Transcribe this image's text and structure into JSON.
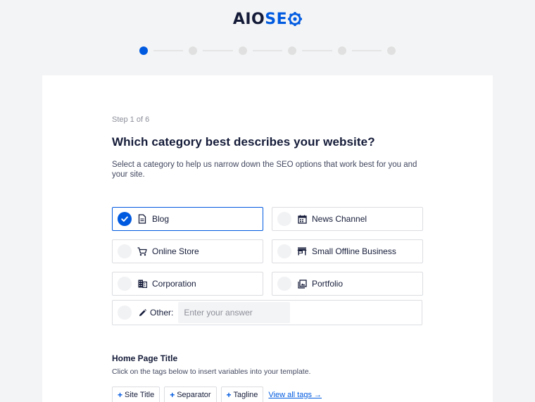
{
  "header": {
    "logo_aio": "AIO",
    "logo_seo": "SE",
    "logo_icon": "gear-icon"
  },
  "stepper": {
    "current_step": 1,
    "total_steps": 6,
    "active_color": "#005ae0"
  },
  "main": {
    "step_label": "Step 1 of 6",
    "heading": "Which category best describes your website?",
    "description": "Select a category to help us narrow down the SEO options that work best for you and your site.",
    "categories": [
      {
        "label": "Blog",
        "icon": "document-icon",
        "selected": true
      },
      {
        "label": "News Channel",
        "icon": "calendar-icon",
        "selected": false
      },
      {
        "label": "Online Store",
        "icon": "cart-icon",
        "selected": false
      },
      {
        "label": "Small Offline Business",
        "icon": "storefront-icon",
        "selected": false
      },
      {
        "label": "Corporation",
        "icon": "building-icon",
        "selected": false
      },
      {
        "label": "Portfolio",
        "icon": "gallery-icon",
        "selected": false
      }
    ],
    "other": {
      "label": "Other:",
      "icon": "pencil-icon",
      "placeholder": "Enter your answer",
      "value": ""
    }
  },
  "home_page_title": {
    "title": "Home Page Title",
    "description": "Click on the tags below to insert variables into your template.",
    "tags": [
      "Site Title",
      "Separator",
      "Tagline"
    ],
    "view_all": "View all tags →"
  }
}
